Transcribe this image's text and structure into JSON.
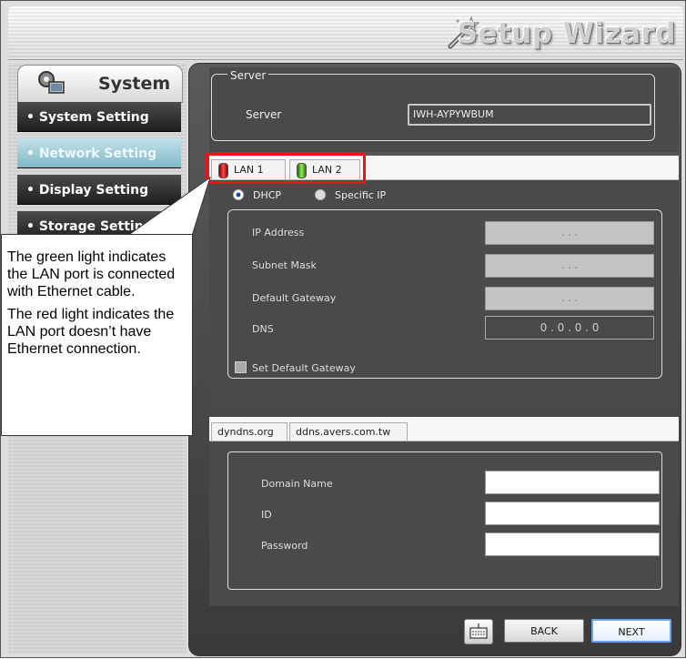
{
  "header": {
    "title": "Setup Wizard"
  },
  "sidebar": {
    "section_label": "System",
    "items": [
      {
        "label": "• System Setting"
      },
      {
        "label": "• Network Setting"
      },
      {
        "label": "• Display Setting"
      },
      {
        "label": "• Storage Setting"
      }
    ]
  },
  "server": {
    "group_label": "Server",
    "field_label": "Server",
    "value": "IWH-AYPYWBUM"
  },
  "lan": {
    "tabs": [
      {
        "label": "LAN 1",
        "led": "red"
      },
      {
        "label": "LAN 2",
        "led": "green"
      }
    ],
    "mode_options": [
      {
        "label": "DHCP",
        "selected": true
      },
      {
        "label": "Specific IP",
        "selected": false
      }
    ],
    "fields": [
      {
        "label": "IP Address",
        "value": ". . ."
      },
      {
        "label": "Subnet Mask",
        "value": ". . ."
      },
      {
        "label": "Default Gateway",
        "value": ". . ."
      },
      {
        "label": "DNS",
        "value": "0 . 0 . 0 . 0"
      }
    ],
    "checkbox_label": "Set Default Gateway"
  },
  "ddns": {
    "tabs": [
      {
        "label": "dyndns.org"
      },
      {
        "label": "ddns.avers.com.tw"
      }
    ],
    "fields": [
      {
        "label": "Domain Name"
      },
      {
        "label": "ID"
      },
      {
        "label": "Password"
      }
    ]
  },
  "buttons": {
    "back": "BACK",
    "next": "NEXT"
  },
  "callout": {
    "green_text": "The green light indicates the LAN port is connected with Ethernet cable.",
    "red_text": "The red light indicates the LAN port doesn’t have Ethernet connection."
  },
  "colors": {
    "highlight": "#e8161b",
    "active_nav": "#8fc3d1",
    "panel_dark": "#4a4a4a"
  }
}
